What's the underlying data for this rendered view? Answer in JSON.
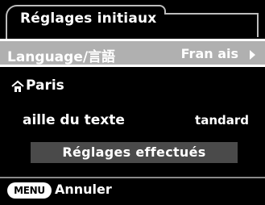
{
  "header": {
    "title": "Réglages initiaux"
  },
  "rows": {
    "language": {
      "label": "Language/言語",
      "value": "Fran ais"
    },
    "home": {
      "label": "Paris",
      "icon": "home-icon"
    },
    "text_size": {
      "label": "aille du texte",
      "value": "tandard"
    }
  },
  "done_button": {
    "label": "Réglages effectués"
  },
  "footer": {
    "menu_key": "MENU",
    "cancel_label": "Annuler"
  },
  "colors": {
    "selected_row": "#b0b0b0",
    "button_bg": "#4a4a4a",
    "background": "#000000"
  }
}
